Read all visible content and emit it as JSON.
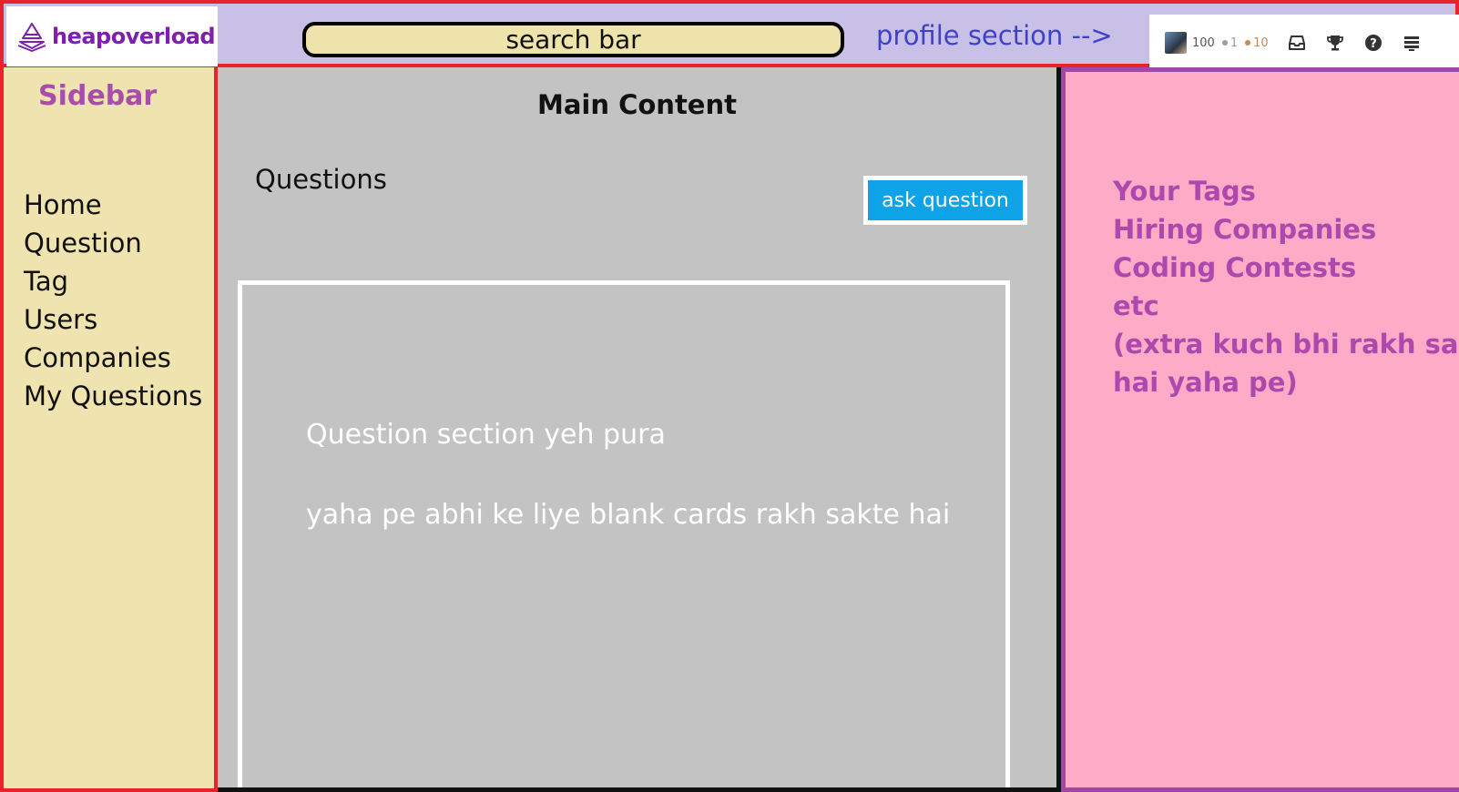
{
  "header": {
    "logo_text": "heapoverload",
    "search_label": "search bar",
    "profile_label": "profile section -->",
    "profile": {
      "reputation": "100",
      "silver_badges": "1",
      "bronze_badges": "10",
      "silver_color": "#9a9fa5",
      "bronze_color": "#c38b5f",
      "icons": [
        "inbox-icon",
        "trophy-icon",
        "help-icon",
        "stack-menu-icon"
      ]
    }
  },
  "sidebar": {
    "title": "Sidebar",
    "items": [
      {
        "label": "Home"
      },
      {
        "label": "Question"
      },
      {
        "label": "Tag"
      },
      {
        "label": "Users"
      },
      {
        "label": "Companies"
      },
      {
        "label": "My Questions"
      }
    ]
  },
  "main": {
    "title": "Main Content",
    "questions_label": "Questions",
    "ask_button": "ask question",
    "section_line_1": "Question section yeh pura",
    "section_line_2": "yaha pe abhi ke liye blank cards rakh sakte hai"
  },
  "right_panel": {
    "items": [
      {
        "label": "Your Tags"
      },
      {
        "label": "Hiring Companies"
      },
      {
        "label": "Coding Contests"
      },
      {
        "label": "etc"
      },
      {
        "label": "(extra kuch bhi rakh sakte"
      },
      {
        "label": "hai yaha pe)"
      }
    ]
  },
  "colors": {
    "header_bg": "#c8c0e6",
    "border_red": "#e8232b",
    "sidebar_bg": "#efe3b0",
    "main_bg": "#c3c3c3",
    "right_bg": "#fdabc7",
    "accent_purple": "#ae48ad",
    "button_blue": "#0ea2e6",
    "profile_text_blue": "#3f42c9"
  }
}
